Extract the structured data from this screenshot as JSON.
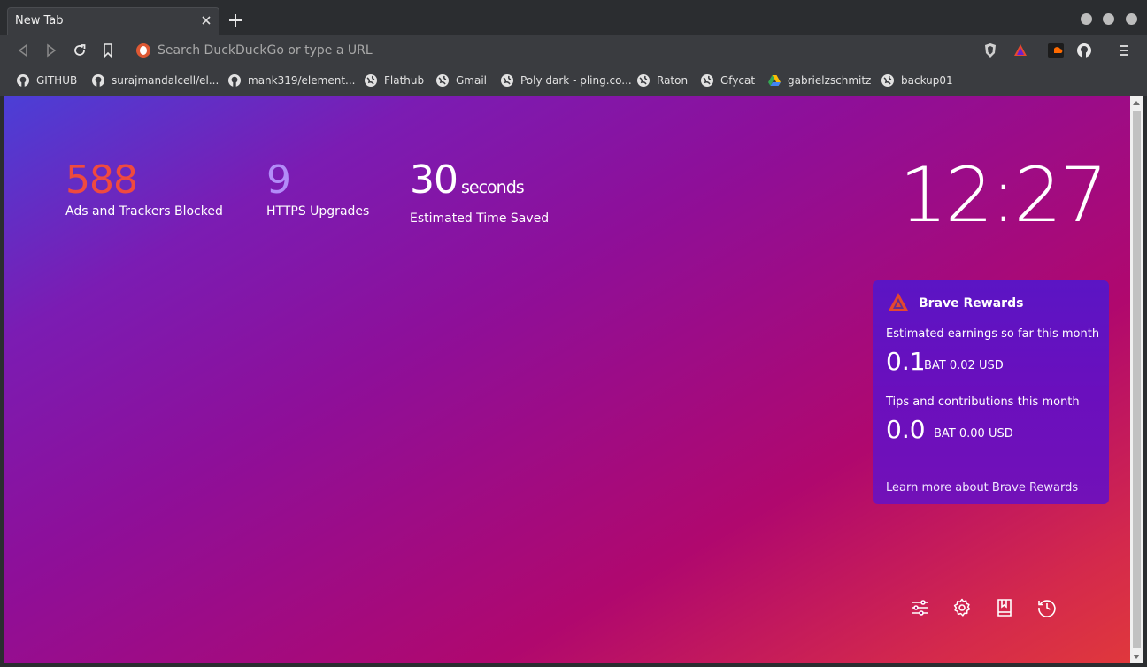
{
  "window": {
    "tab_title": "New Tab"
  },
  "toolbar": {
    "omnibox_placeholder": "Search DuckDuckGo or type a URL"
  },
  "bookmarks": [
    {
      "label": "GITHUB",
      "icon": "github-icon"
    },
    {
      "label": "surajmandalcell/el...",
      "icon": "github-icon"
    },
    {
      "label": "mank319/element...",
      "icon": "github-icon"
    },
    {
      "label": "Flathub",
      "icon": "globe-icon"
    },
    {
      "label": "Gmail",
      "icon": "globe-icon"
    },
    {
      "label": "Poly dark - pling.co...",
      "icon": "globe-icon"
    },
    {
      "label": "Raton",
      "icon": "globe-icon"
    },
    {
      "label": "Gfycat",
      "icon": "globe-icon"
    },
    {
      "label": "gabrielzschmitz",
      "icon": "google-drive-icon"
    },
    {
      "label": "backup01",
      "icon": "globe-icon"
    }
  ],
  "stats": {
    "ads_blocked": {
      "value": "588",
      "label": "Ads and Trackers Blocked",
      "color": "#ef4a3f"
    },
    "https_upgrades": {
      "value": "9",
      "label": "HTTPS Upgrades",
      "color": "#b28cf8"
    },
    "time_saved": {
      "value": "30",
      "unit": "seconds",
      "label": "Estimated Time Saved",
      "color": "#ffffff"
    }
  },
  "clock": "12:27",
  "rewards": {
    "title": "Brave Rewards",
    "earnings_label": "Estimated earnings so far this month",
    "earnings_value": "0.1",
    "earnings_sub": "BAT 0.02 USD",
    "tips_label": "Tips and contributions this month",
    "tips_value": "0.0",
    "tips_sub": "BAT 0.00 USD",
    "learn_more": "Learn more about Brave Rewards"
  },
  "colors": {
    "gradient_start": "#4b3fd6",
    "gradient_end": "#e0383c",
    "rewards_card": "#5b15c4"
  }
}
